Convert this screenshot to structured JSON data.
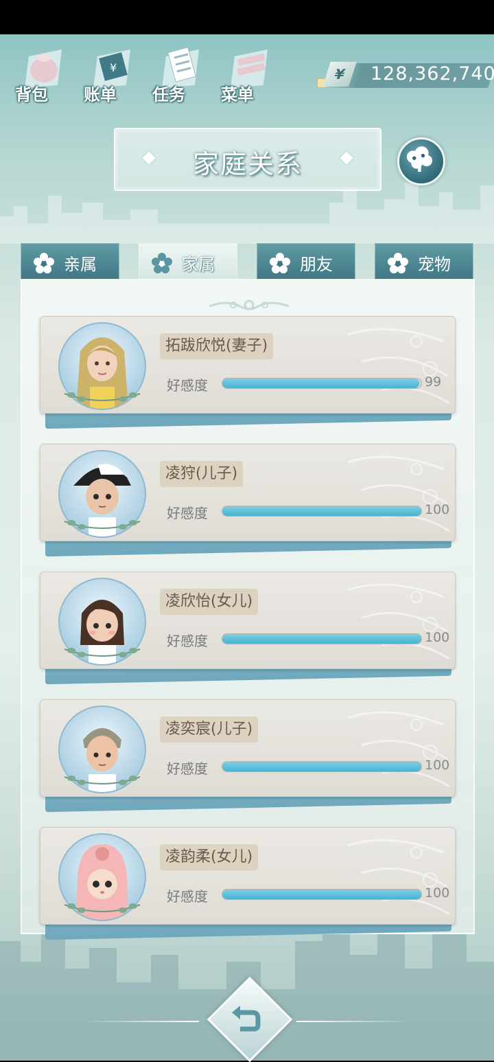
{
  "top_nav": [
    {
      "label": "背包",
      "icon": "backpack-icon"
    },
    {
      "label": "账单",
      "icon": "bill-icon"
    },
    {
      "label": "任务",
      "icon": "task-icon"
    },
    {
      "label": "菜单",
      "icon": "menu-icon"
    }
  ],
  "money": {
    "symbol": "¥",
    "value": "128,362,740"
  },
  "title": "家庭关系",
  "tabs": [
    {
      "label": "亲属",
      "active": false
    },
    {
      "label": "家属",
      "active": true
    },
    {
      "label": "朋友",
      "active": false
    },
    {
      "label": "宠物",
      "active": false
    }
  ],
  "affection_label": "好感度",
  "members": [
    {
      "name": "拓跋欣悦(妻子)",
      "affection": 99,
      "affection_text": "99"
    },
    {
      "name": "凌狩(儿子)",
      "affection": 100,
      "affection_text": "100"
    },
    {
      "name": "凌欣怡(女儿)",
      "affection": 100,
      "affection_text": "100"
    },
    {
      "name": "凌奕宸(儿子)",
      "affection": 100,
      "affection_text": "100"
    },
    {
      "name": "凌韵柔(女儿)",
      "affection": 100,
      "affection_text": "100"
    }
  ],
  "colors": {
    "accent_bar": "#48b3d1",
    "tab_inactive": "#4f8a95",
    "name_text": "#6b5a4c"
  }
}
